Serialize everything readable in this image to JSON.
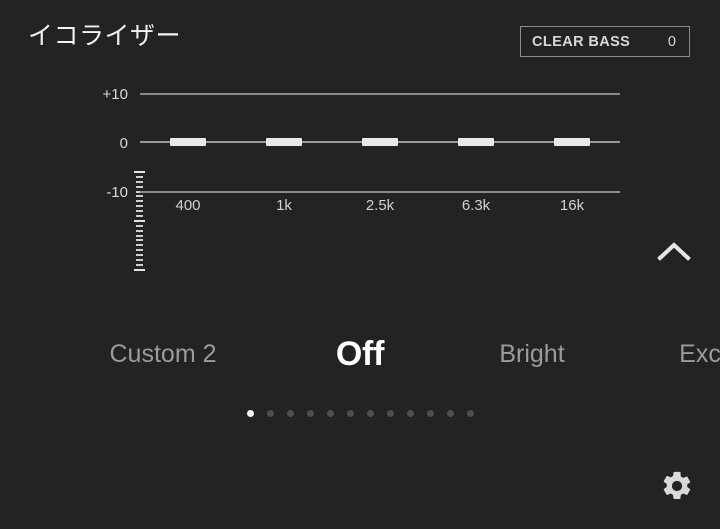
{
  "header": {
    "title": "イコライザー",
    "clear_bass": {
      "label": "CLEAR BASS",
      "value": "0"
    }
  },
  "chart_data": {
    "type": "bar",
    "title": "イコライザー",
    "xlabel": "",
    "ylabel": "",
    "categories": [
      "400",
      "1k",
      "2.5k",
      "6.3k",
      "16k"
    ],
    "values": [
      0,
      0,
      0,
      0,
      0
    ],
    "ylim": [
      -10,
      10
    ],
    "y_ticks": [
      "+10",
      "0",
      "-10"
    ],
    "grid": true,
    "legend": "none",
    "annotations": [
      "CLEAR BASS 0"
    ]
  },
  "eq": {
    "y_labels": {
      "max": "+10",
      "zero": "0",
      "min": "-10"
    },
    "bands": [
      {
        "freq": "400",
        "value": 0
      },
      {
        "freq": "1k",
        "value": 0
      },
      {
        "freq": "2.5k",
        "value": 0
      },
      {
        "freq": "6.3k",
        "value": 0
      },
      {
        "freq": "16k",
        "value": 0
      }
    ]
  },
  "presets": {
    "items": [
      {
        "label": "Custom 2",
        "active": false
      },
      {
        "label": "Off",
        "active": true
      },
      {
        "label": "Bright",
        "active": false
      },
      {
        "label": "Exc",
        "active": false
      }
    ]
  },
  "pager": {
    "total": 12,
    "active_index": 0
  },
  "icons": {
    "chevron_up": "chevron-up-icon",
    "gear": "gear-icon"
  },
  "colors": {
    "background": "#232323",
    "accent": "#ffffff",
    "handle": "#e9e9e9",
    "gridline": "#8c8c8c",
    "inactive_text": "#9b9b9b",
    "dot_inactive": "#4e4e4e"
  }
}
